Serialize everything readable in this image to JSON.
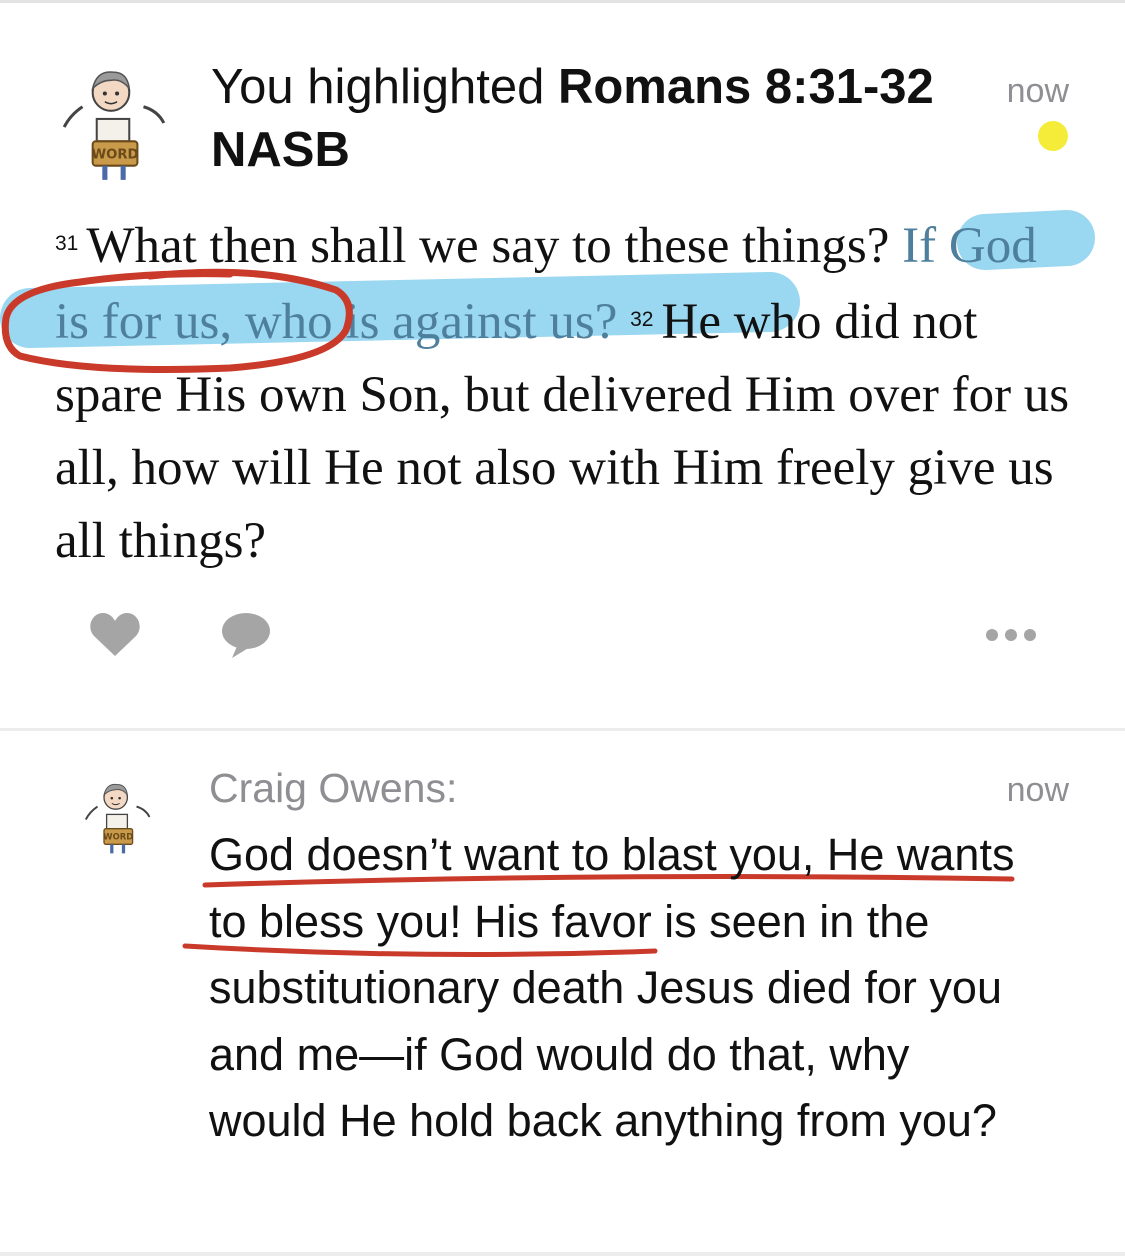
{
  "highlight_card": {
    "prefix": "You highlighted ",
    "reference": "Romans 8:31-32",
    "translation": "NASB",
    "timestamp": "now",
    "highlight_color": "#f5ec3a",
    "avatar": "cartoon-avatar-holding-word-sign",
    "avatar_sign_text": "WORD",
    "verse": {
      "v31_number": "31",
      "v31_text": "What then shall we say to these things? ",
      "v31_highlighted": "If God is for us, who is against us?",
      "v32_number": "32",
      "v32_text": "He who did not spare His own Son, but delivered Him over for us all, how will He not also with Him freely give us all things?"
    },
    "actions": {
      "like": "heart-icon",
      "comment": "speech-bubble-icon",
      "more": "ellipsis-icon"
    }
  },
  "comment": {
    "author": "Craig Owens:",
    "timestamp": "now",
    "avatar": "cartoon-avatar-holding-word-sign",
    "text": "God doesn’t want to blast you, He wants to bless you! His favor is seen in the substitutionary death Jesus died for you and me—if God would do that, why would He hold back anything from you?"
  },
  "colors": {
    "verse_highlight": "#8fd3ef",
    "highlighted_text": "#4e7f9c",
    "annotation_marker": "#c93a2a",
    "timestamp_gray": "#8e8e93",
    "icon_gray": "#a5a5a5"
  }
}
